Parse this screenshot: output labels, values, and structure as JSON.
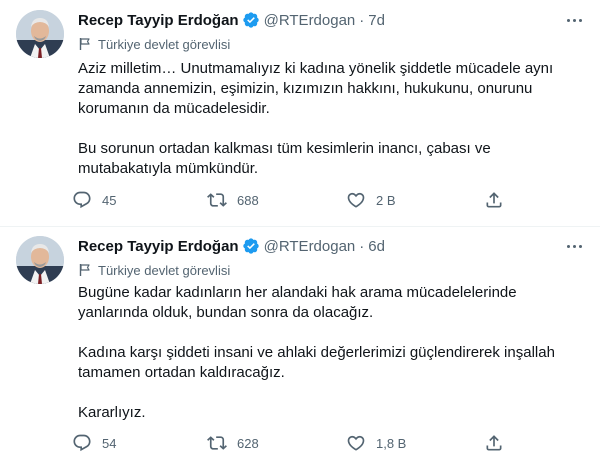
{
  "tweets": [
    {
      "author_name": "Recep Tayyip Erdoğan",
      "handle": "@RTErdogan",
      "separator": "·",
      "time": "7d",
      "label": "Türkiye devlet görevlisi",
      "body": {
        "p1_l1": "Aziz milletim… Unutmamalıyız ki kadına yönelik şiddetle mücadele aynı",
        "p1_l2": "zamanda annemizin, eşimizin, kızımızın hakkını, hukukunu, onurunu",
        "p1_l3": "korumanın da mücadelesidir.",
        "p2_l1": "Bu sorunun ortadan kalkması tüm kesimlerin inancı, çabası ve",
        "p2_l2": "mutabakatıyla mümkündür."
      },
      "replies": "45",
      "retweets": "688",
      "likes": "2 B"
    },
    {
      "author_name": "Recep Tayyip Erdoğan",
      "handle": "@RTErdogan",
      "separator": "·",
      "time": "6d",
      "label": "Türkiye devlet görevlisi",
      "body": {
        "p1_l1": "Bugüne kadar kadınların her alandaki hak arama mücadelelerinde",
        "p1_l2": "yanlarında olduk, bundan sonra da olacağız.",
        "p2_l1": "Kadına karşı şiddeti insani ve ahlaki değerlerimizi güçlendirerek inşallah",
        "p2_l2": "tamamen ortadan kaldıracağız.",
        "p3_l1": "Kararlıyız."
      },
      "replies": "54",
      "retweets": "628",
      "likes": "1,8 B"
    }
  ],
  "icons": {
    "verified": "verified-badge-icon",
    "label": "government-flag-icon",
    "reply": "reply-icon",
    "retweet": "retweet-icon",
    "like": "heart-icon",
    "share": "share-icon",
    "more": "more-options-icon"
  },
  "colors": {
    "text": "#0f1419",
    "muted": "#536471",
    "verified": "#1d9bf0",
    "divider": "#eff3f4"
  }
}
